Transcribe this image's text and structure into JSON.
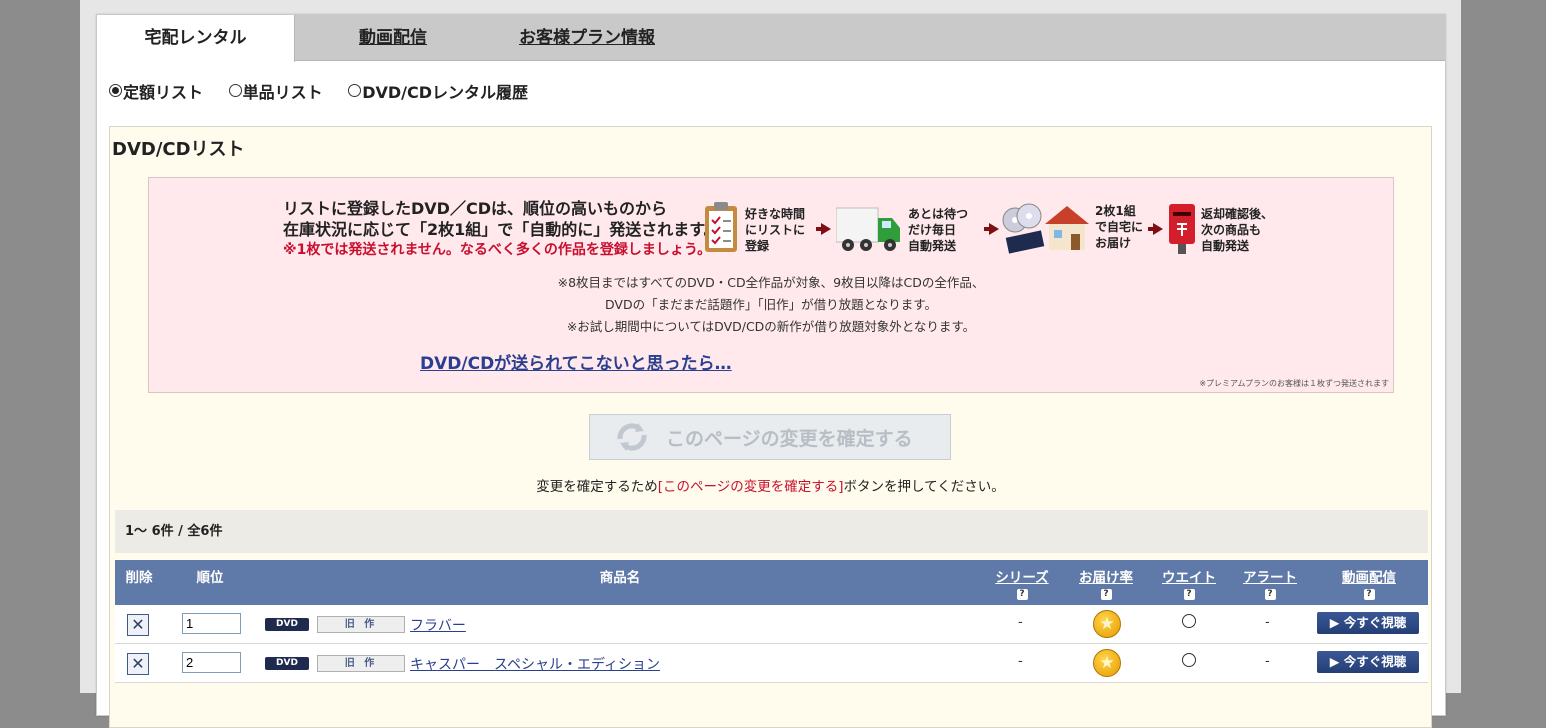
{
  "tabs": [
    {
      "label": "宅配レンタル",
      "active": true
    },
    {
      "label": "動画配信",
      "active": false
    },
    {
      "label": "お客様プラン情報",
      "active": false
    }
  ],
  "radios": [
    {
      "label": "定額リスト",
      "checked": true
    },
    {
      "label": "単品リスト",
      "checked": false
    },
    {
      "label": "DVD/CDレンタル履歴",
      "checked": false
    }
  ],
  "list_title": "DVD/CDリスト",
  "info": {
    "headline_1": "リストに登録したDVD／CDは、順位の高いものから",
    "headline_2": "在庫状況に応じて「2枚1組」で「自動的に」発送されます。",
    "headline_red": "※1枚では発送されません。なるべく多くの作品を登録しましょう。",
    "steps": [
      {
        "icon": "clipboard-icon",
        "text_1": "好きな時間",
        "text_2": "にリストに",
        "text_3": "登録"
      },
      {
        "icon": "truck-icon",
        "text_1": "あとは待つ",
        "text_2": "だけ毎日",
        "text_3": "自動発送"
      },
      {
        "icon": "house-discs-icon",
        "text_1": "2枚1組",
        "text_2": "で自宅に",
        "text_3": "お届け"
      },
      {
        "icon": "postbox-icon",
        "text_1": "返却確認後、",
        "text_2": "次の商品も",
        "text_3": "自動発送"
      }
    ],
    "note_1": "※8枚目まではすべてのDVD・CD全作品が対象、9枚目以降はCDの全作品、",
    "note_2": "DVDの「まだまだ話題作」「旧作」が借り放題となります。",
    "note_3": "※お試し期間中についてはDVD/CDの新作が借り放題対象外となります。",
    "link": "DVD/CDが送られてこないと思ったら…",
    "small_note": "※プレミアムプランのお客様は１枚ずつ発送されます"
  },
  "confirm": {
    "button_label": "このページの変更を確定する",
    "msg_pre": "変更を確定するため",
    "msg_red": "[このページの変更を確定する]",
    "msg_post": "ボタンを押してください。"
  },
  "count_text": "1～ 6件 / 全6件",
  "table": {
    "headers": {
      "delete": "削除",
      "rank": "順位",
      "title": "商品名",
      "series": "シリーズ",
      "rate": "お届け率",
      "weight": "ウエイト",
      "alert": "アラート",
      "stream": "動画配信"
    },
    "help": "?",
    "rows": [
      {
        "delete": "✕",
        "rank": "1",
        "format": "DVD",
        "category": "旧 作",
        "title": "フラバー",
        "series": "-",
        "rate": "star",
        "weight": "○",
        "alert": "-",
        "stream": "▶ 今すぐ視聴"
      },
      {
        "delete": "✕",
        "rank": "2",
        "format": "DVD",
        "category": "旧 作",
        "title": "キャスパー　スペシャル・エディション",
        "series": "-",
        "rate": "star",
        "weight": "○",
        "alert": "-",
        "stream": "▶ 今すぐ視聴"
      }
    ]
  },
  "colors": {
    "tab_bar": "#c9c9c9",
    "header_blue": "#5f7aa8",
    "info_pink": "#ffe9ec",
    "link_blue": "#2a3f8f",
    "red": "#c8102e",
    "list_bg": "#fffcee"
  }
}
